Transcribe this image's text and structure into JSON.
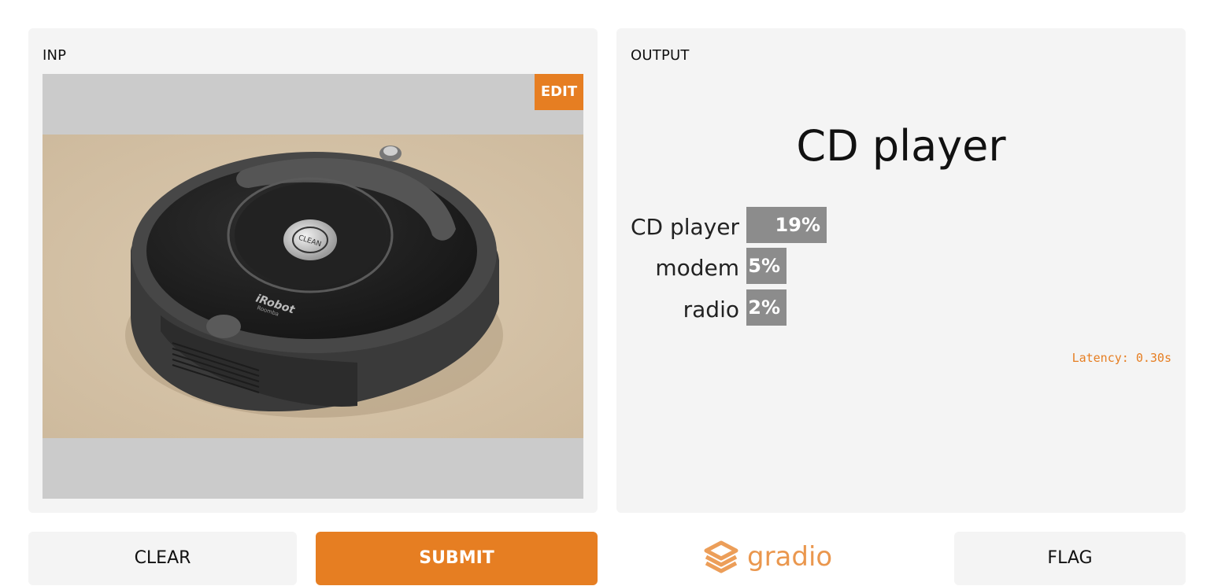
{
  "input_panel": {
    "title": "INP",
    "edit_label": "EDIT",
    "image_subject": "robot vacuum cleaner photo",
    "image_text": {
      "button": "CLEAN",
      "brand": "iRobot",
      "model": "Roomba"
    }
  },
  "output_panel": {
    "title": "OUTPUT",
    "top_label": "CD player",
    "confidences": [
      {
        "label": "CD player",
        "percent_text": "19%",
        "value": 0.19
      },
      {
        "label": "modem",
        "percent_text": "5%",
        "value": 0.05
      },
      {
        "label": "radio",
        "percent_text": "2%",
        "value": 0.02
      }
    ],
    "latency": "Latency: 0.30s"
  },
  "buttons": {
    "clear": "CLEAR",
    "submit": "SUBMIT",
    "flag": "FLAG"
  },
  "branding": {
    "logo_text": "gradio",
    "logo_icon": "gradio-logo-icon"
  },
  "colors": {
    "accent": "#e67e22",
    "panel_bg": "#f4f4f4",
    "image_bg": "#cbcbcb",
    "bar": "#8c8c8c"
  }
}
